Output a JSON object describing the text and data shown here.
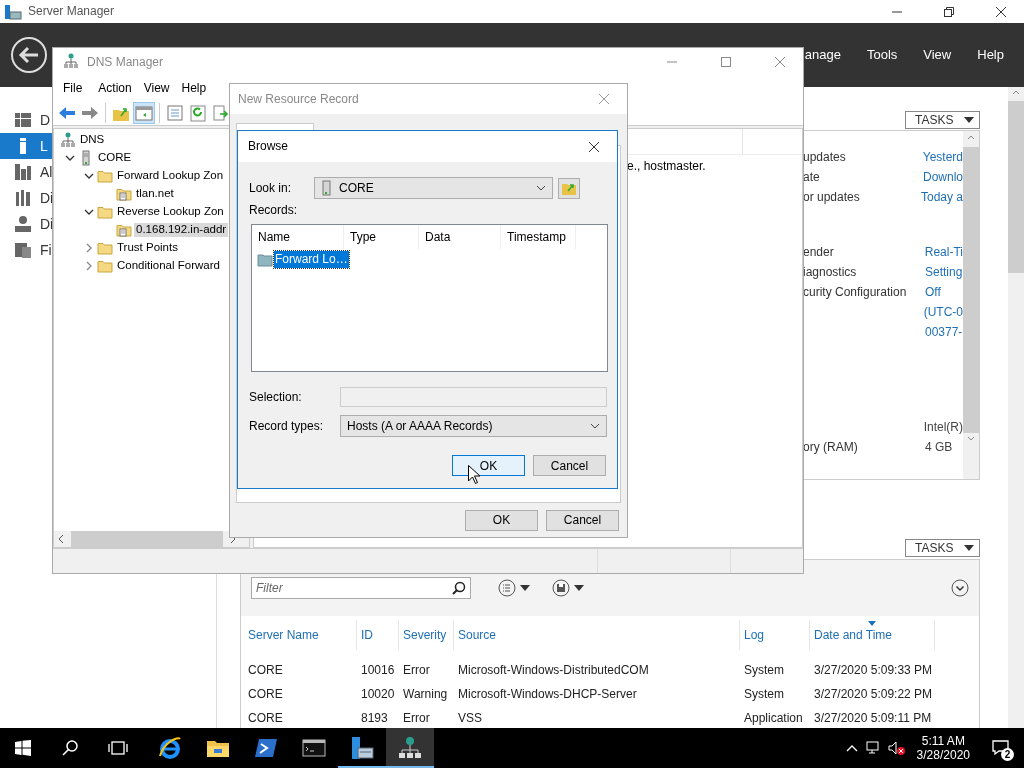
{
  "server_manager": {
    "title": "Server Manager",
    "menu": [
      "anage",
      "Tools",
      "View",
      "Help"
    ],
    "nav": [
      {
        "label": "D",
        "kind": "dashboard",
        "selected": false
      },
      {
        "label": "L",
        "kind": "local",
        "selected": true
      },
      {
        "label": "Al",
        "kind": "servers",
        "selected": false
      },
      {
        "label": "Di",
        "kind": "dhcp",
        "selected": false
      },
      {
        "label": "Di",
        "kind": "dns",
        "selected": false
      },
      {
        "label": "Fi",
        "kind": "files",
        "selected": false
      }
    ],
    "properties": {
      "tasks": "TASKS",
      "groups": [
        [
          {
            "label": "updates",
            "value": "Yesterd",
            "link": true
          },
          {
            "label": "ate",
            "value": "Downlo",
            "link": true
          },
          {
            "label": "or updates",
            "value": "Today a",
            "link": true
          }
        ],
        [
          {
            "label": "ender",
            "value": "Real-Ti",
            "link": true
          },
          {
            "label": "iagnostics",
            "value": "Setting",
            "link": true
          },
          {
            "label": "curity Configuration",
            "value": "Off",
            "link": true
          },
          {
            "value": "(UTC-0",
            "link": true
          },
          {
            "value": "00377-",
            "link": true
          }
        ],
        [
          {
            "value": "Intel(R)",
            "link": false
          },
          {
            "label": "ory (RAM)",
            "value": "4 GB",
            "link": false
          }
        ]
      ]
    },
    "events": {
      "tasks": "TASKS",
      "filter_placeholder": "Filter",
      "columns": [
        {
          "label": "Server Name",
          "sorted": false
        },
        {
          "label": "ID",
          "sorted": false
        },
        {
          "label": "Severity",
          "sorted": false
        },
        {
          "label": "Source",
          "sorted": false
        },
        {
          "label": "Log",
          "sorted": false
        },
        {
          "label": "Date and Time",
          "sorted": true
        }
      ],
      "rows": [
        [
          "CORE",
          "10016",
          "Error",
          "Microsoft-Windows-DistributedCOM",
          "System",
          "3/27/2020 5:09:33 PM"
        ],
        [
          "CORE",
          "10020",
          "Warning",
          "Microsoft-Windows-DHCP-Server",
          "System",
          "3/27/2020 5:09:22 PM"
        ],
        [
          "CORE",
          "8193",
          "Error",
          "VSS",
          "Application",
          "3/27/2020 5:09:11 PM"
        ]
      ]
    }
  },
  "dns_manager": {
    "title": "DNS Manager",
    "menu": [
      "File",
      "Action",
      "View",
      "Help"
    ],
    "toolbar": [
      {
        "kind": "back",
        "pressed": false
      },
      {
        "kind": "forward",
        "pressed": false
      },
      {
        "kind": "separator"
      },
      {
        "kind": "up",
        "pressed": false
      },
      {
        "kind": "tree",
        "pressed": true
      },
      {
        "kind": "separator"
      },
      {
        "kind": "properties",
        "pressed": false
      },
      {
        "kind": "refresh",
        "pressed": false
      },
      {
        "kind": "export",
        "pressed": false
      }
    ],
    "tree": [
      {
        "label": "DNS",
        "kind": "dns",
        "selected": false,
        "children": [
          {
            "label": "CORE",
            "kind": "server",
            "expanded": true,
            "selected": false,
            "children": [
              {
                "label": "Forward Lookup Zon",
                "kind": "folder",
                "expanded": true,
                "selected": false,
                "children": [
                  {
                    "label": "tlan.net",
                    "kind": "zone",
                    "selected": false
                  }
                ]
              },
              {
                "label": "Reverse Lookup Zon",
                "kind": "folder",
                "expanded": true,
                "selected": false,
                "children": [
                  {
                    "label": "0.168.192.in-addr",
                    "kind": "zone",
                    "selected": true
                  }
                ]
              },
              {
                "label": "Trust Points",
                "kind": "folder",
                "expanded": false,
                "selected": false
              },
              {
                "label": "Conditional Forward",
                "kind": "folder",
                "expanded": false,
                "selected": false
              }
            ]
          }
        ]
      }
    ],
    "detail_text": "e., hostmaster."
  },
  "new_resource_record": {
    "title": "New Resource Record",
    "buttons": [
      "OK",
      "Cancel"
    ]
  },
  "browse": {
    "title": "Browse",
    "look_in_label": "Look in:",
    "look_in": "CORE",
    "records_label": "Records:",
    "columns": [
      "Name",
      "Type",
      "Data",
      "Timestamp"
    ],
    "records": [
      {
        "name": "Forward Lo…",
        "selected": true
      }
    ],
    "selection_label": "Selection:",
    "record_types_label": "Record types:",
    "record_types": "Hosts (A or AAAA Records)",
    "buttons": [
      {
        "label": "OK",
        "default": true
      },
      {
        "label": "Cancel",
        "default": false
      }
    ]
  },
  "taskbar": {
    "apps": [
      {
        "kind": "ie",
        "running": false,
        "selected": false
      },
      {
        "kind": "explorer",
        "running": false,
        "selected": false
      },
      {
        "kind": "powershell",
        "running": false,
        "selected": false
      },
      {
        "kind": "cmd",
        "running": false,
        "selected": false
      },
      {
        "kind": "servermanager",
        "running": true,
        "selected": false
      },
      {
        "kind": "dns",
        "running": true,
        "selected": true
      }
    ],
    "time": "5:11 AM",
    "date": "3/28/2020",
    "notifications": "2"
  }
}
